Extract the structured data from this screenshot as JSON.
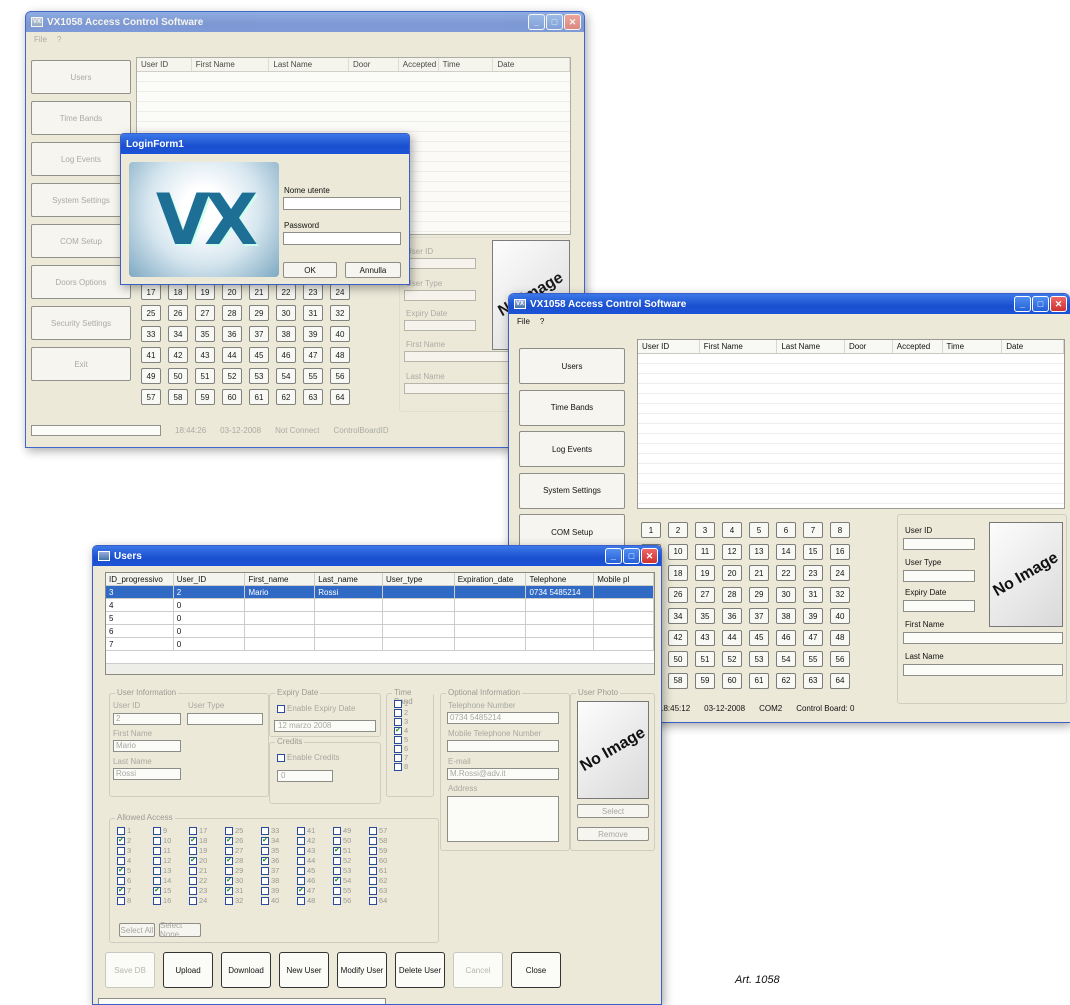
{
  "app_title": "VX1058 Access Control Software",
  "menu": [
    "File",
    "?"
  ],
  "sidebar": [
    "Users",
    "Time Bands",
    "Log Events",
    "System Settings",
    "COM Setup",
    "Doors Options",
    "Security Settings",
    "Exit"
  ],
  "log_columns": [
    "User ID",
    "First Name",
    "Last Name",
    "Door",
    "Accepted",
    "Time",
    "Date"
  ],
  "doors": [
    "1",
    "2",
    "3",
    "4",
    "5",
    "6",
    "7",
    "8",
    "9",
    "10",
    "11",
    "12",
    "13",
    "14",
    "15",
    "16",
    "17",
    "18",
    "19",
    "20",
    "21",
    "22",
    "23",
    "24",
    "25",
    "26",
    "27",
    "28",
    "29",
    "30",
    "31",
    "32",
    "33",
    "34",
    "35",
    "36",
    "37",
    "38",
    "39",
    "40",
    "41",
    "42",
    "43",
    "44",
    "45",
    "46",
    "47",
    "48",
    "49",
    "50",
    "51",
    "52",
    "53",
    "54",
    "55",
    "56",
    "57",
    "58",
    "59",
    "60",
    "61",
    "62",
    "63",
    "64"
  ],
  "user_panel": {
    "user_id": "User ID",
    "user_type": "User Type",
    "expiry": "Expiry Date",
    "first": "First Name",
    "last": "Last Name",
    "no_image": "No Image"
  },
  "login": {
    "title": "LoginForm1",
    "user_label": "Nome utente",
    "pass_label": "Password",
    "ok": "OK",
    "cancel": "Annulla",
    "logo": "VX"
  },
  "status_back": {
    "time": "18:44:26",
    "date": "03-12-2008",
    "conn": "Not Connect",
    "board": "ControlBoardID"
  },
  "status_front": {
    "time": "18:45:12",
    "date": "03-12-2008",
    "conn": "COM2",
    "board": "Control Board: 0"
  },
  "users_window": {
    "title": "Users",
    "columns": [
      "ID_progressivo",
      "User_ID",
      "First_name",
      "Last_name",
      "User_type",
      "Expiration_date",
      "Telephone",
      "Mobile pl"
    ],
    "rows": [
      [
        "3",
        "2",
        "Mario",
        "Rossi",
        "",
        "",
        "0734 5485214",
        ""
      ],
      [
        "4",
        "0",
        "",
        "",
        "",
        "",
        "",
        ""
      ],
      [
        "5",
        "0",
        "",
        "",
        "",
        "",
        "",
        ""
      ],
      [
        "6",
        "0",
        "",
        "",
        "",
        "",
        "",
        ""
      ],
      [
        "7",
        "0",
        "",
        "",
        "",
        "",
        "",
        ""
      ]
    ],
    "user_info": "User Information",
    "user_id_lbl": "User ID",
    "user_type_lbl": "User Type",
    "user_id_val": "2",
    "first_lbl": "First Name",
    "first_val": "Mario",
    "last_lbl": "Last Name",
    "last_val": "Rossi",
    "expiry_group": "Expiry Date",
    "enable_expiry": "Enable Expiry Date",
    "expiry_val": "12 marzo 2008",
    "credits_group": "Credits",
    "enable_credits": "Enable Credits",
    "credits_val": "0",
    "time_band": "Time Band",
    "time_band_items": [
      "1",
      "2",
      "3",
      "4",
      "5",
      "6",
      "7",
      "8"
    ],
    "optional": "Optional Information",
    "tel_lbl": "Telephone Number",
    "tel_val": "0734 5485214",
    "mobile_lbl": "Mobile Telephone Number",
    "email_lbl": "E-mail",
    "email_val": "M.Rossi@adv.it",
    "address_lbl": "Address",
    "photo": "User Photo",
    "select": "Select",
    "remove": "Remove",
    "allowed": "Allowed Access",
    "select_all": "Select All",
    "select_none": "Select None",
    "buttons": [
      "Save DB",
      "Upload",
      "Download",
      "New User",
      "Modify User",
      "Delete User",
      "Cancel",
      "Close"
    ]
  },
  "caption": "Art. 1058"
}
